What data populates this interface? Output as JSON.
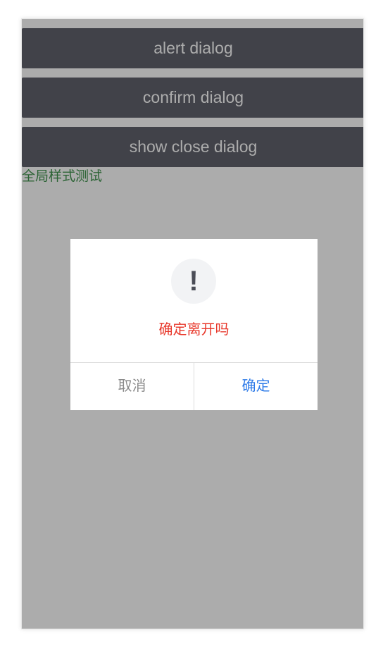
{
  "buttons": {
    "alert": "alert dialog",
    "confirm": "confirm dialog",
    "show_close": "show close dialog"
  },
  "global_style_test": "全局样式测试",
  "dialog": {
    "icon": "!",
    "icon_name": "exclamation-icon",
    "message": "确定离开吗",
    "cancel_label": "取消",
    "confirm_label": "确定"
  },
  "colors": {
    "button_bg": "#3d3f4b",
    "message_text": "#e8372a",
    "confirm_text": "#2e7be8",
    "cancel_text": "#8a8a8a",
    "global_test_text": "#157a26"
  }
}
